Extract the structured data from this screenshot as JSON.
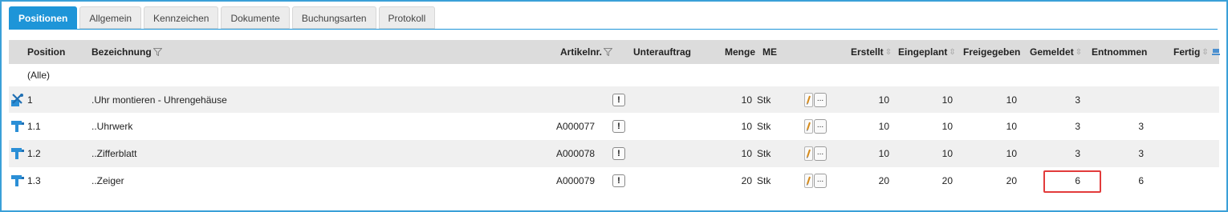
{
  "tabs": [
    {
      "label": "Positionen",
      "active": true
    },
    {
      "label": "Allgemein"
    },
    {
      "label": "Kennzeichen"
    },
    {
      "label": "Dokumente"
    },
    {
      "label": "Buchungsarten"
    },
    {
      "label": "Protokoll"
    }
  ],
  "columns": {
    "position": "Position",
    "bezeichnung": "Bezeichnung",
    "artikelnr": "Artikelnr.",
    "unterauftrag": "Unterauftrag",
    "menge": "Menge",
    "me": "ME",
    "erstellt": "Erstellt",
    "eingeplant": "Eingeplant",
    "freigegeben": "Freigegeben",
    "gemeldet": "Gemeldet",
    "entnommen": "Entnommen",
    "fertig": "Fertig"
  },
  "filter_row": {
    "alle": "(Alle)"
  },
  "rows": [
    {
      "icon": "assembly-tools-icon",
      "position": "1",
      "bezeichnung": ".Uhr montieren - Uhrengehäuse",
      "artikelnr": "",
      "warn": "!",
      "menge": "10",
      "me": "Stk",
      "dots": "...",
      "erstellt": "10",
      "eingeplant": "10",
      "freigegeben": "10",
      "gemeldet": "3",
      "entnommen": "",
      "fertig": ""
    },
    {
      "icon": "part-icon",
      "position": "1.1",
      "bezeichnung": "..Uhrwerk",
      "artikelnr": "A000077",
      "warn": "!",
      "menge": "10",
      "me": "Stk",
      "dots": "...",
      "erstellt": "10",
      "eingeplant": "10",
      "freigegeben": "10",
      "gemeldet": "3",
      "entnommen": "3",
      "fertig": ""
    },
    {
      "icon": "part-icon",
      "position": "1.2",
      "bezeichnung": "..Zifferblatt",
      "artikelnr": "A000078",
      "warn": "!",
      "menge": "10",
      "me": "Stk",
      "dots": "...",
      "erstellt": "10",
      "eingeplant": "10",
      "freigegeben": "10",
      "gemeldet": "3",
      "entnommen": "3",
      "fertig": ""
    },
    {
      "icon": "part-icon",
      "position": "1.3",
      "bezeichnung": "..Zeiger",
      "artikelnr": "A000079",
      "warn": "!",
      "menge": "20",
      "me": "Stk",
      "dots": "...",
      "erstellt": "20",
      "eingeplant": "20",
      "freigegeben": "20",
      "gemeldet": "6",
      "entnommen": "6",
      "fertig": ""
    }
  ],
  "colors": {
    "accent": "#1e95d8",
    "header_bg": "#dcdcdc",
    "highlight": "#e23b3b",
    "alt_row": "#f0f0f0"
  }
}
